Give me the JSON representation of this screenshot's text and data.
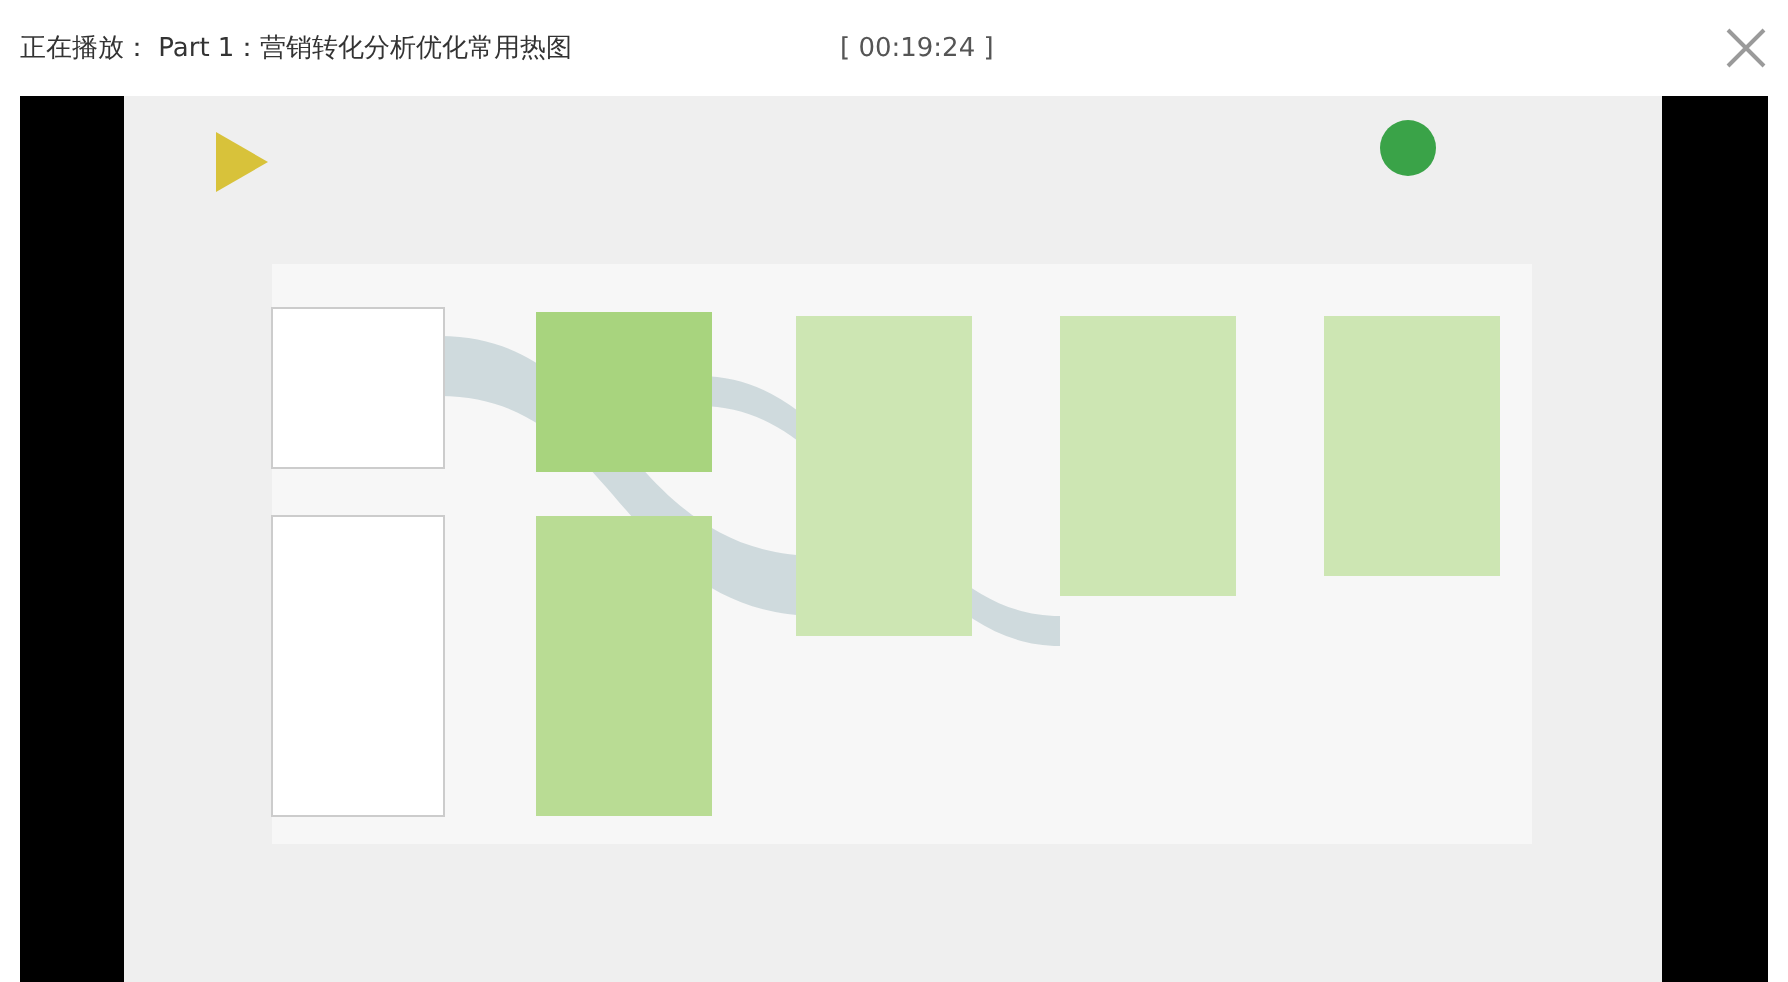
{
  "player": {
    "title": "正在播放： Part 1：营销转化分析优化常用热图",
    "timestamp": "[ 00:19:24 ]"
  }
}
